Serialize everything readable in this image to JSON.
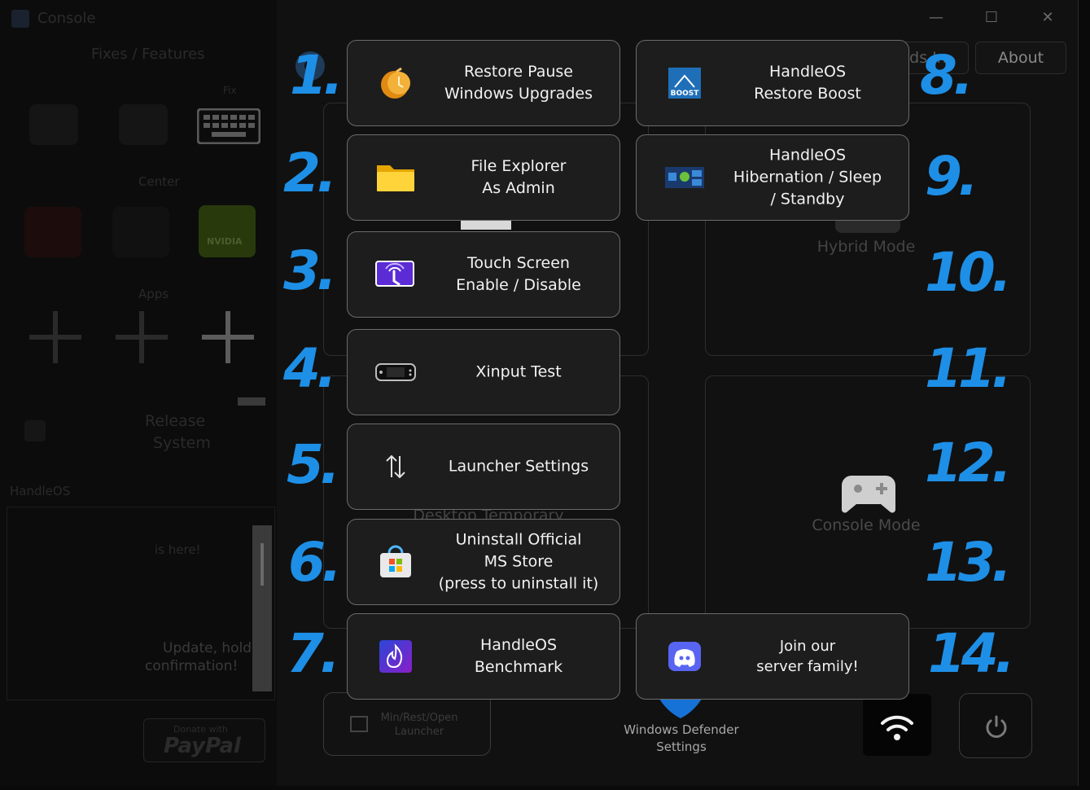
{
  "window": {
    "title": "Console",
    "minimize_glyph": "—",
    "maximize_glyph": "☐",
    "close_glyph": "✕"
  },
  "background": {
    "left_features_header": "Fixes / Features",
    "fix_label": "Fix",
    "apps_header": "Apps",
    "release_text_1": "Release",
    "release_text_2": "System",
    "handle_section": "HandleOS",
    "here_text": "is here!",
    "update_text_1": "Update, hold",
    "update_text_2": "confirmation!",
    "paypal_small": "Donate with",
    "paypal_big": "PayPal",
    "nvidia_label": "NVIDIA",
    "about_button": "About",
    "downloads_partial": "ds In",
    "hybrid_mode": "Hybrid Mode",
    "console_mode": "Console Mode",
    "desktop_temporary": "Desktop Temporary",
    "min_rest_open": "Min/Rest/Open\nLauncher",
    "windows_defender": "Windows Defender\nSettings"
  },
  "numbers": [
    "1.",
    "2.",
    "3.",
    "4.",
    "5.",
    "6.",
    "7.",
    "8.",
    "9.",
    "10.",
    "11.",
    "12.",
    "13.",
    "14."
  ],
  "buttons": {
    "restore_pause": {
      "label": "Restore Pause\nWindows Upgrades",
      "icon": "timer-pause-icon"
    },
    "file_explorer": {
      "label": "File Explorer\nAs Admin",
      "icon": "folder-icon"
    },
    "touch_screen": {
      "label": "Touch Screen\nEnable / Disable",
      "icon": "touch-screen-icon"
    },
    "xinput_test": {
      "label": "Xinput Test",
      "icon": "handheld-console-icon"
    },
    "launcher_settings": {
      "label": "Launcher Settings",
      "icon": "up-down-arrows-icon"
    },
    "uninstall_store": {
      "label": "Uninstall Official\nMS Store\n(press to uninstall it)",
      "icon": "ms-store-icon"
    },
    "benchmark": {
      "label": "HandleOS\nBenchmark",
      "icon": "flame-icon"
    },
    "restore_boost": {
      "label": "HandleOS\nRestore Boost",
      "icon": "boost-icon",
      "icon_text": "BOOST"
    },
    "hibernation": {
      "label": "HandleOS\nHibernation / Sleep\n/ Standby",
      "icon": "power-states-icon"
    },
    "discord": {
      "label": "Join our\nserver family!",
      "icon": "discord-icon"
    }
  },
  "colors": {
    "accent_number": "#1e8fe6",
    "button_bg": "#1d1d1d",
    "button_border": "#6b6b6b"
  }
}
